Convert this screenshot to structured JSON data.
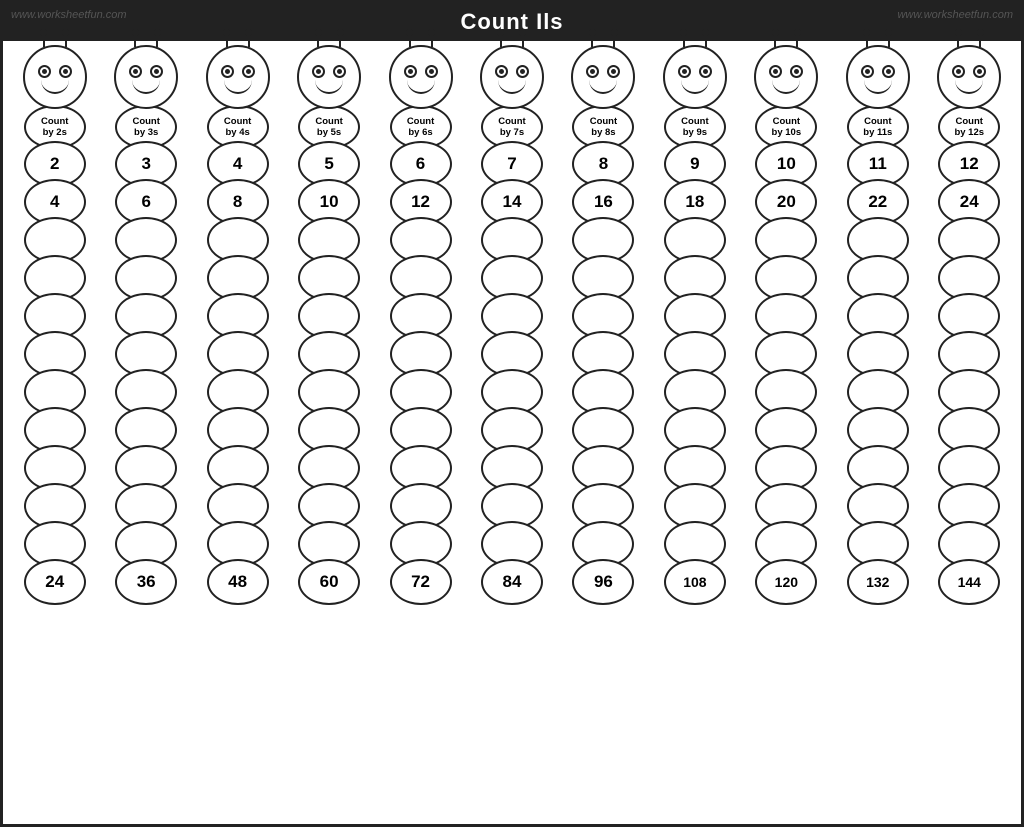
{
  "watermark": "www.worksheetfun.com",
  "title": "Count Ils",
  "caterpillars": [
    {
      "label": "Count\nby 2s",
      "start1": "2",
      "start2": "4",
      "end": "24",
      "step": 2,
      "total_segs": 12
    },
    {
      "label": "Count\nby 3s",
      "start1": "3",
      "start2": "6",
      "end": "36",
      "step": 3,
      "total_segs": 12
    },
    {
      "label": "Count\nby 4s",
      "start1": "4",
      "start2": "8",
      "end": "48",
      "step": 4,
      "total_segs": 12
    },
    {
      "label": "Count\nby 5s",
      "start1": "5",
      "start2": "10",
      "end": "60",
      "step": 5,
      "total_segs": 12
    },
    {
      "label": "Count\nby 6s",
      "start1": "6",
      "start2": "12",
      "end": "72",
      "step": 6,
      "total_segs": 12
    },
    {
      "label": "Count\nby 7s",
      "start1": "7",
      "start2": "14",
      "end": "84",
      "step": 7,
      "total_segs": 12
    },
    {
      "label": "Count\nby 8s",
      "start1": "8",
      "start2": "16",
      "end": "96",
      "step": 8,
      "total_segs": 12
    },
    {
      "label": "Count\nby 9s",
      "start1": "9",
      "start2": "18",
      "end": "108",
      "step": 9,
      "total_segs": 12
    },
    {
      "label": "Count\nby 10s",
      "start1": "10",
      "start2": "20",
      "end": "120",
      "step": 10,
      "total_segs": 12
    },
    {
      "label": "Count\nby 11s",
      "start1": "11",
      "start2": "22",
      "end": "132",
      "step": 11,
      "total_segs": 12
    },
    {
      "label": "Count\nby 12s",
      "start1": "12",
      "start2": "24",
      "end": "144",
      "step": 12,
      "total_segs": 12
    }
  ]
}
